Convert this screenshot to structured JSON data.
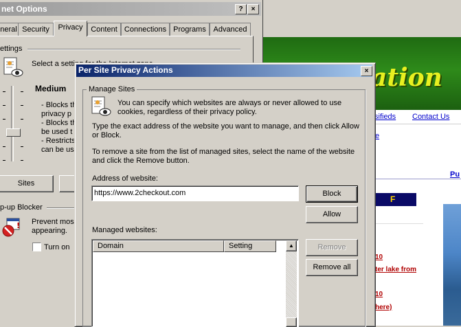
{
  "browser": {
    "banner_text": "ation",
    "links": {
      "classifieds": "sifieds",
      "contact_us": "Contact Us",
      "fragment_e": "e",
      "fragment_pu": "Pu",
      "fragment_10a": "10",
      "fragment_lake": "ter lake from",
      "fragment_10b": "10",
      "fragment_here": "here)"
    },
    "navy_bar_letter": "F"
  },
  "options_window": {
    "title": "net Options",
    "title_buttons": {
      "help": "?",
      "close": "×"
    },
    "tabs": [
      {
        "label": "neral"
      },
      {
        "label": "Security"
      },
      {
        "label": "Privacy"
      },
      {
        "label": "Content"
      },
      {
        "label": "Connections"
      },
      {
        "label": "Programs"
      },
      {
        "label": "Advanced"
      }
    ],
    "settings_label": "ettings",
    "select_setting_text": "Select a setting for the Internet zone.",
    "level": "Medium",
    "level_lines": [
      "- Blocks th",
      "privacy p",
      "- Blocks th",
      "be used t",
      "- Restricts",
      "can be us"
    ],
    "sites_button": "Sites",
    "popup_label": "p-up Blocker",
    "popup_text": [
      "Prevent mos",
      "appearing."
    ],
    "turn_on_label": "Turn on"
  },
  "dialog": {
    "title": "Per Site Privacy Actions",
    "close_button": "×",
    "group_label": "Manage Sites",
    "intro_text": [
      "You can specify which websites are always or never allowed to use",
      "cookies, regardless of their privacy policy."
    ],
    "instructions_1": [
      "Type the exact address of the website you want to manage, and then click Allow",
      "or Block."
    ],
    "instructions_2": [
      "To remove a site from the list of managed sites, select the name of the website",
      "and click the Remove button."
    ],
    "address_label": "Address of website:",
    "address_value": "https://www.2checkout.com",
    "block_button": "Block",
    "allow_button": "Allow",
    "managed_label": "Managed websites:",
    "columns": {
      "domain": "Domain",
      "setting": "Setting"
    },
    "remove_button": "Remove",
    "remove_all_button": "Remove all",
    "scroll_up_glyph": "▲"
  }
}
